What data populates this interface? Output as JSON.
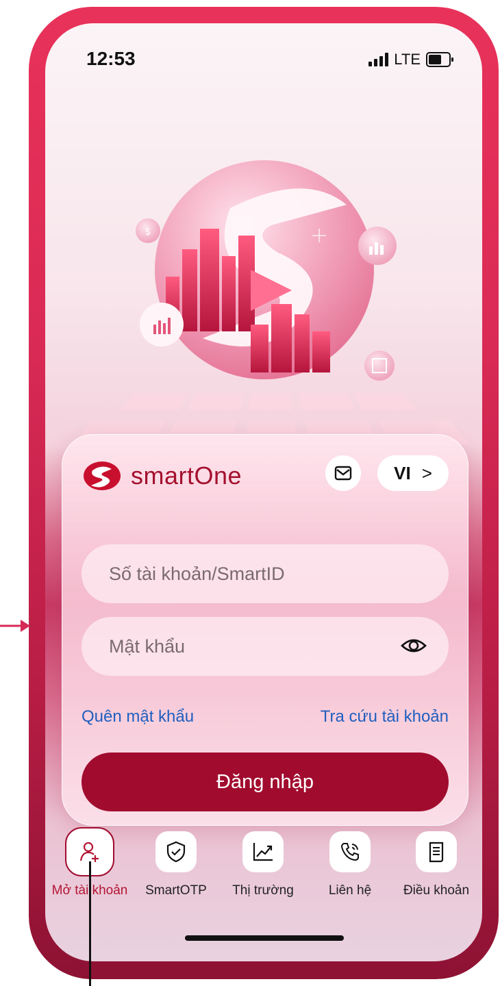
{
  "status_bar": {
    "time": "12:53",
    "network": "LTE"
  },
  "brand": {
    "name": "smartOne",
    "accent": "#a10c2e"
  },
  "header": {
    "language": "VI",
    "language_chevron": ">"
  },
  "form": {
    "account_placeholder": "Số tài khoản/SmartID",
    "password_placeholder": "Mật khẩu",
    "forgot_link": "Quên mật khẩu",
    "lookup_link": "Tra cứu tài khoản",
    "login_button": "Đăng nhập"
  },
  "nav": {
    "items": [
      {
        "label": "Mở tài khoản",
        "icon": "add-user-icon",
        "active": true
      },
      {
        "label": "SmartOTP",
        "icon": "shield-check-icon",
        "active": false
      },
      {
        "label": "Thị trường",
        "icon": "chart-trend-icon",
        "active": false
      },
      {
        "label": "Liên hệ",
        "icon": "phone-call-icon",
        "active": false
      },
      {
        "label": "Điều khoản",
        "icon": "document-icon",
        "active": false
      }
    ]
  }
}
